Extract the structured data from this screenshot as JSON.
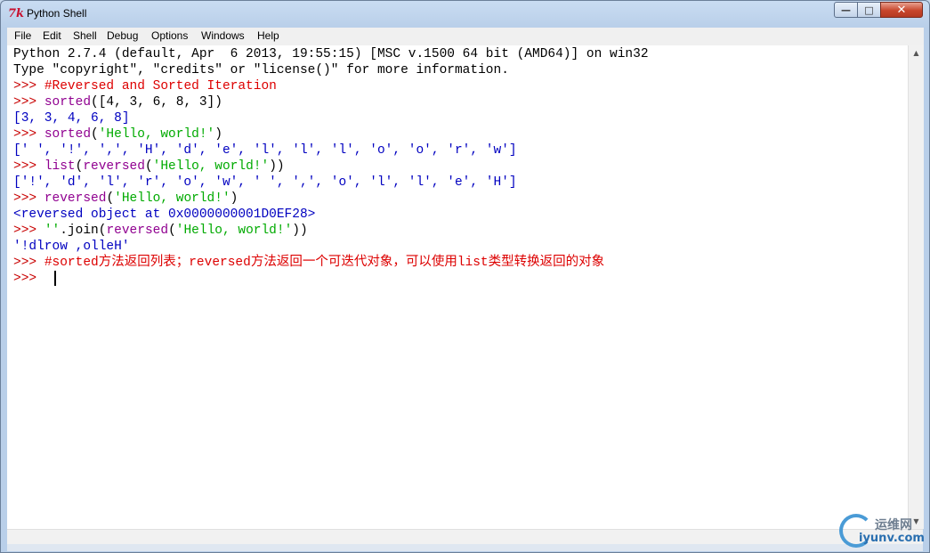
{
  "window": {
    "title": "Python Shell",
    "app_icon": "7k"
  },
  "menu": [
    "File",
    "Edit",
    "Shell",
    "Debug",
    "Options",
    "Windows",
    "Help"
  ],
  "colors": {
    "prompt": "#c80000",
    "comment": "#dd0000",
    "builtin": "#900090",
    "string": "#00aa00",
    "output": "#0000c0"
  },
  "console": {
    "l1": "Python 2.7.4 (default, Apr  6 2013, 19:55:15) [MSC v.1500 64 bit (AMD64)] on win32",
    "l2": "Type \"copyright\", \"credits\" or \"license()\" for more information.",
    "prompt": ">>> ",
    "l3_comment": "#Reversed and Sorted Iteration",
    "l4_fn": "sorted",
    "l4_args": "([4, 3, 6, 8, 3])",
    "l5_out": "[3, 3, 4, 6, 8]",
    "l6_fn": "sorted",
    "l6_open": "(",
    "l6_str": "'Hello, world!'",
    "l6_close": ")",
    "l7_out": "[' ', '!', ',', 'H', 'd', 'e', 'l', 'l', 'l', 'o', 'o', 'r', 'w']",
    "l8_fn1": "list",
    "l8_open1": "(",
    "l8_fn2": "reversed",
    "l8_open2": "(",
    "l8_str": "'Hello, world!'",
    "l8_close": "))",
    "l9_out": "['!', 'd', 'l', 'r', 'o', 'w', ' ', ',', 'o', 'l', 'l', 'e', 'H']",
    "l10_fn": "reversed",
    "l10_open": "(",
    "l10_str": "'Hello, world!'",
    "l10_close": ")",
    "l11_out": "<reversed object at 0x0000000001D0EF28>",
    "l12_str1": "''",
    "l12_join": ".join(",
    "l12_fn": "reversed",
    "l12_open": "(",
    "l12_str2": "'Hello, world!'",
    "l12_close": "))",
    "l13_out": "'!dlrow ,olleH'",
    "l14_comment": "#sorted方法返回列表；reversed方法返回一个可迭代对象，可以使用list类型转换返回的对象",
    "l15_prompt": ">>> "
  },
  "watermark": {
    "line1": "运维网",
    "line2": "iyunv.com"
  }
}
